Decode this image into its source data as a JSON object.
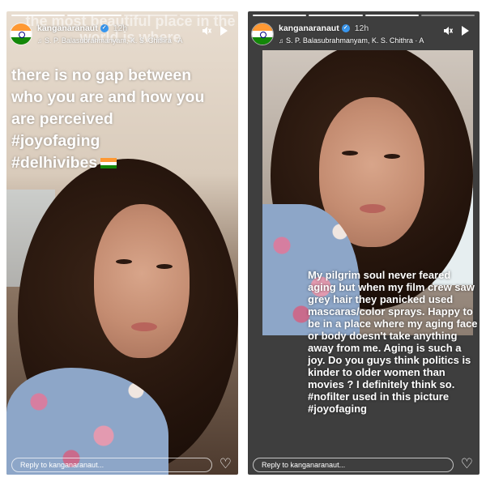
{
  "left_story": {
    "username": "kanganaranaut",
    "time": "12h",
    "music": "S. P. Balasubrahmanyam, K. S. Chithra · A",
    "ghost_text": "the most beautiful place in the world is where",
    "text_lines": [
      "there is no gap between",
      "who you are and how you",
      "are perceived",
      "#joyofaging",
      "#delhivibes"
    ],
    "reply_placeholder": "Reply to kanganaranaut..."
  },
  "right_story": {
    "username": "kanganaranaut",
    "time": "12h",
    "music": "S. P. Balasubrahmanyam, K. S. Chithra · A",
    "caption": "My pilgrim soul never feared aging but when my film crew saw grey hair they panicked used mascaras/color sprays. Happy to be in a place where my aging face or body doesn't take anything away from me. Aging is such a joy. Do you guys think politics is kinder to older women than movies ? I definitely think so. #nofilter used in this picture #joyofaging",
    "reply_placeholder": "Reply to kanganaranaut..."
  },
  "icons": {
    "verified": "verified-badge-icon",
    "music": "music-note-icon",
    "mute": "speaker-muted-icon",
    "play": "play-icon",
    "heart": "heart-icon",
    "flag": "india-flag-icon"
  },
  "colors": {
    "verified_blue": "#3897f0",
    "flag_saffron": "#ff9933",
    "flag_white": "#ffffff",
    "flag_green": "#138808"
  }
}
